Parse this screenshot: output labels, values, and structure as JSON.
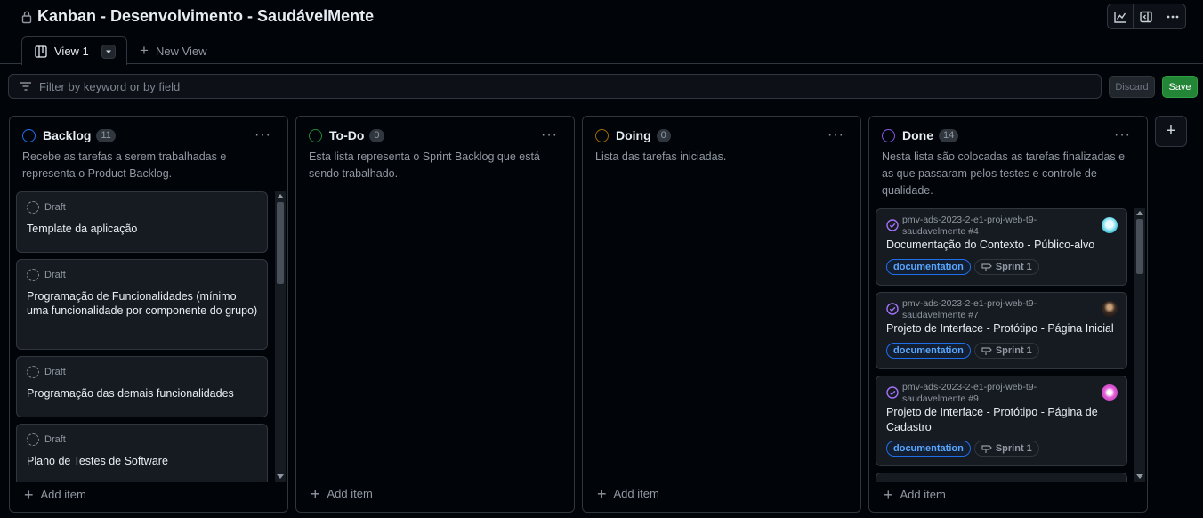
{
  "project": {
    "title": "Kanban - Desenvolvimento - SaudávelMente"
  },
  "header_buttons": {
    "insights_icon": "graph-icon",
    "panel_icon": "sidebar-icon",
    "more_icon": "kebab-icon"
  },
  "tabs": {
    "active": "View 1",
    "new_view": "New View"
  },
  "filter": {
    "placeholder": "Filter by keyword or by field",
    "discard": "Discard",
    "save": "Save"
  },
  "colors": {
    "backlog": "#1f6feb",
    "todo": "#238636",
    "doing": "#9e6a03",
    "done": "#8957e5",
    "accent_save": "#238636"
  },
  "columns": {
    "backlog": {
      "name": "Backlog",
      "count": "11",
      "description": "Recebe as tarefas a serem trabalhadas e representa o Product Backlog.",
      "add_item": "Add item",
      "cards": [
        {
          "status": "Draft",
          "title": "Template da aplicação"
        },
        {
          "status": "Draft",
          "title": "Programação de Funcionalidades (mínimo uma funcionalidade por componente do grupo)"
        },
        {
          "status": "Draft",
          "title": "Programação das demais funcionalidades"
        },
        {
          "status": "Draft",
          "title": "Plano de Testes de Software"
        }
      ]
    },
    "todo": {
      "name": "To-Do",
      "count": "0",
      "description": "Esta lista representa o Sprint Backlog que está sendo trabalhado.",
      "add_item": "Add item"
    },
    "doing": {
      "name": "Doing",
      "count": "0",
      "description": "Lista das tarefas iniciadas.",
      "add_item": "Add item"
    },
    "done": {
      "name": "Done",
      "count": "14",
      "description": "Nesta lista são colocadas as tarefas finalizadas e as que passaram pelos testes e controle de qualidade.",
      "add_item": "Add item",
      "cards": [
        {
          "repo": "pmv-ads-2023-2-e1-proj-web-t9-saudavelmente #4",
          "title": "Documentação do Contexto - Público-alvo",
          "label": "documentation",
          "sprint": "Sprint 1"
        },
        {
          "repo": "pmv-ads-2023-2-e1-proj-web-t9-saudavelmente #7",
          "title": "Projeto de Interface - Protótipo - Página Inicial",
          "label": "documentation",
          "sprint": "Sprint 1"
        },
        {
          "repo": "pmv-ads-2023-2-e1-proj-web-t9-saudavelmente #9",
          "title": "Projeto de Interface - Protótipo - Página de Cadastro",
          "label": "documentation",
          "sprint": "Sprint 1"
        }
      ]
    }
  }
}
